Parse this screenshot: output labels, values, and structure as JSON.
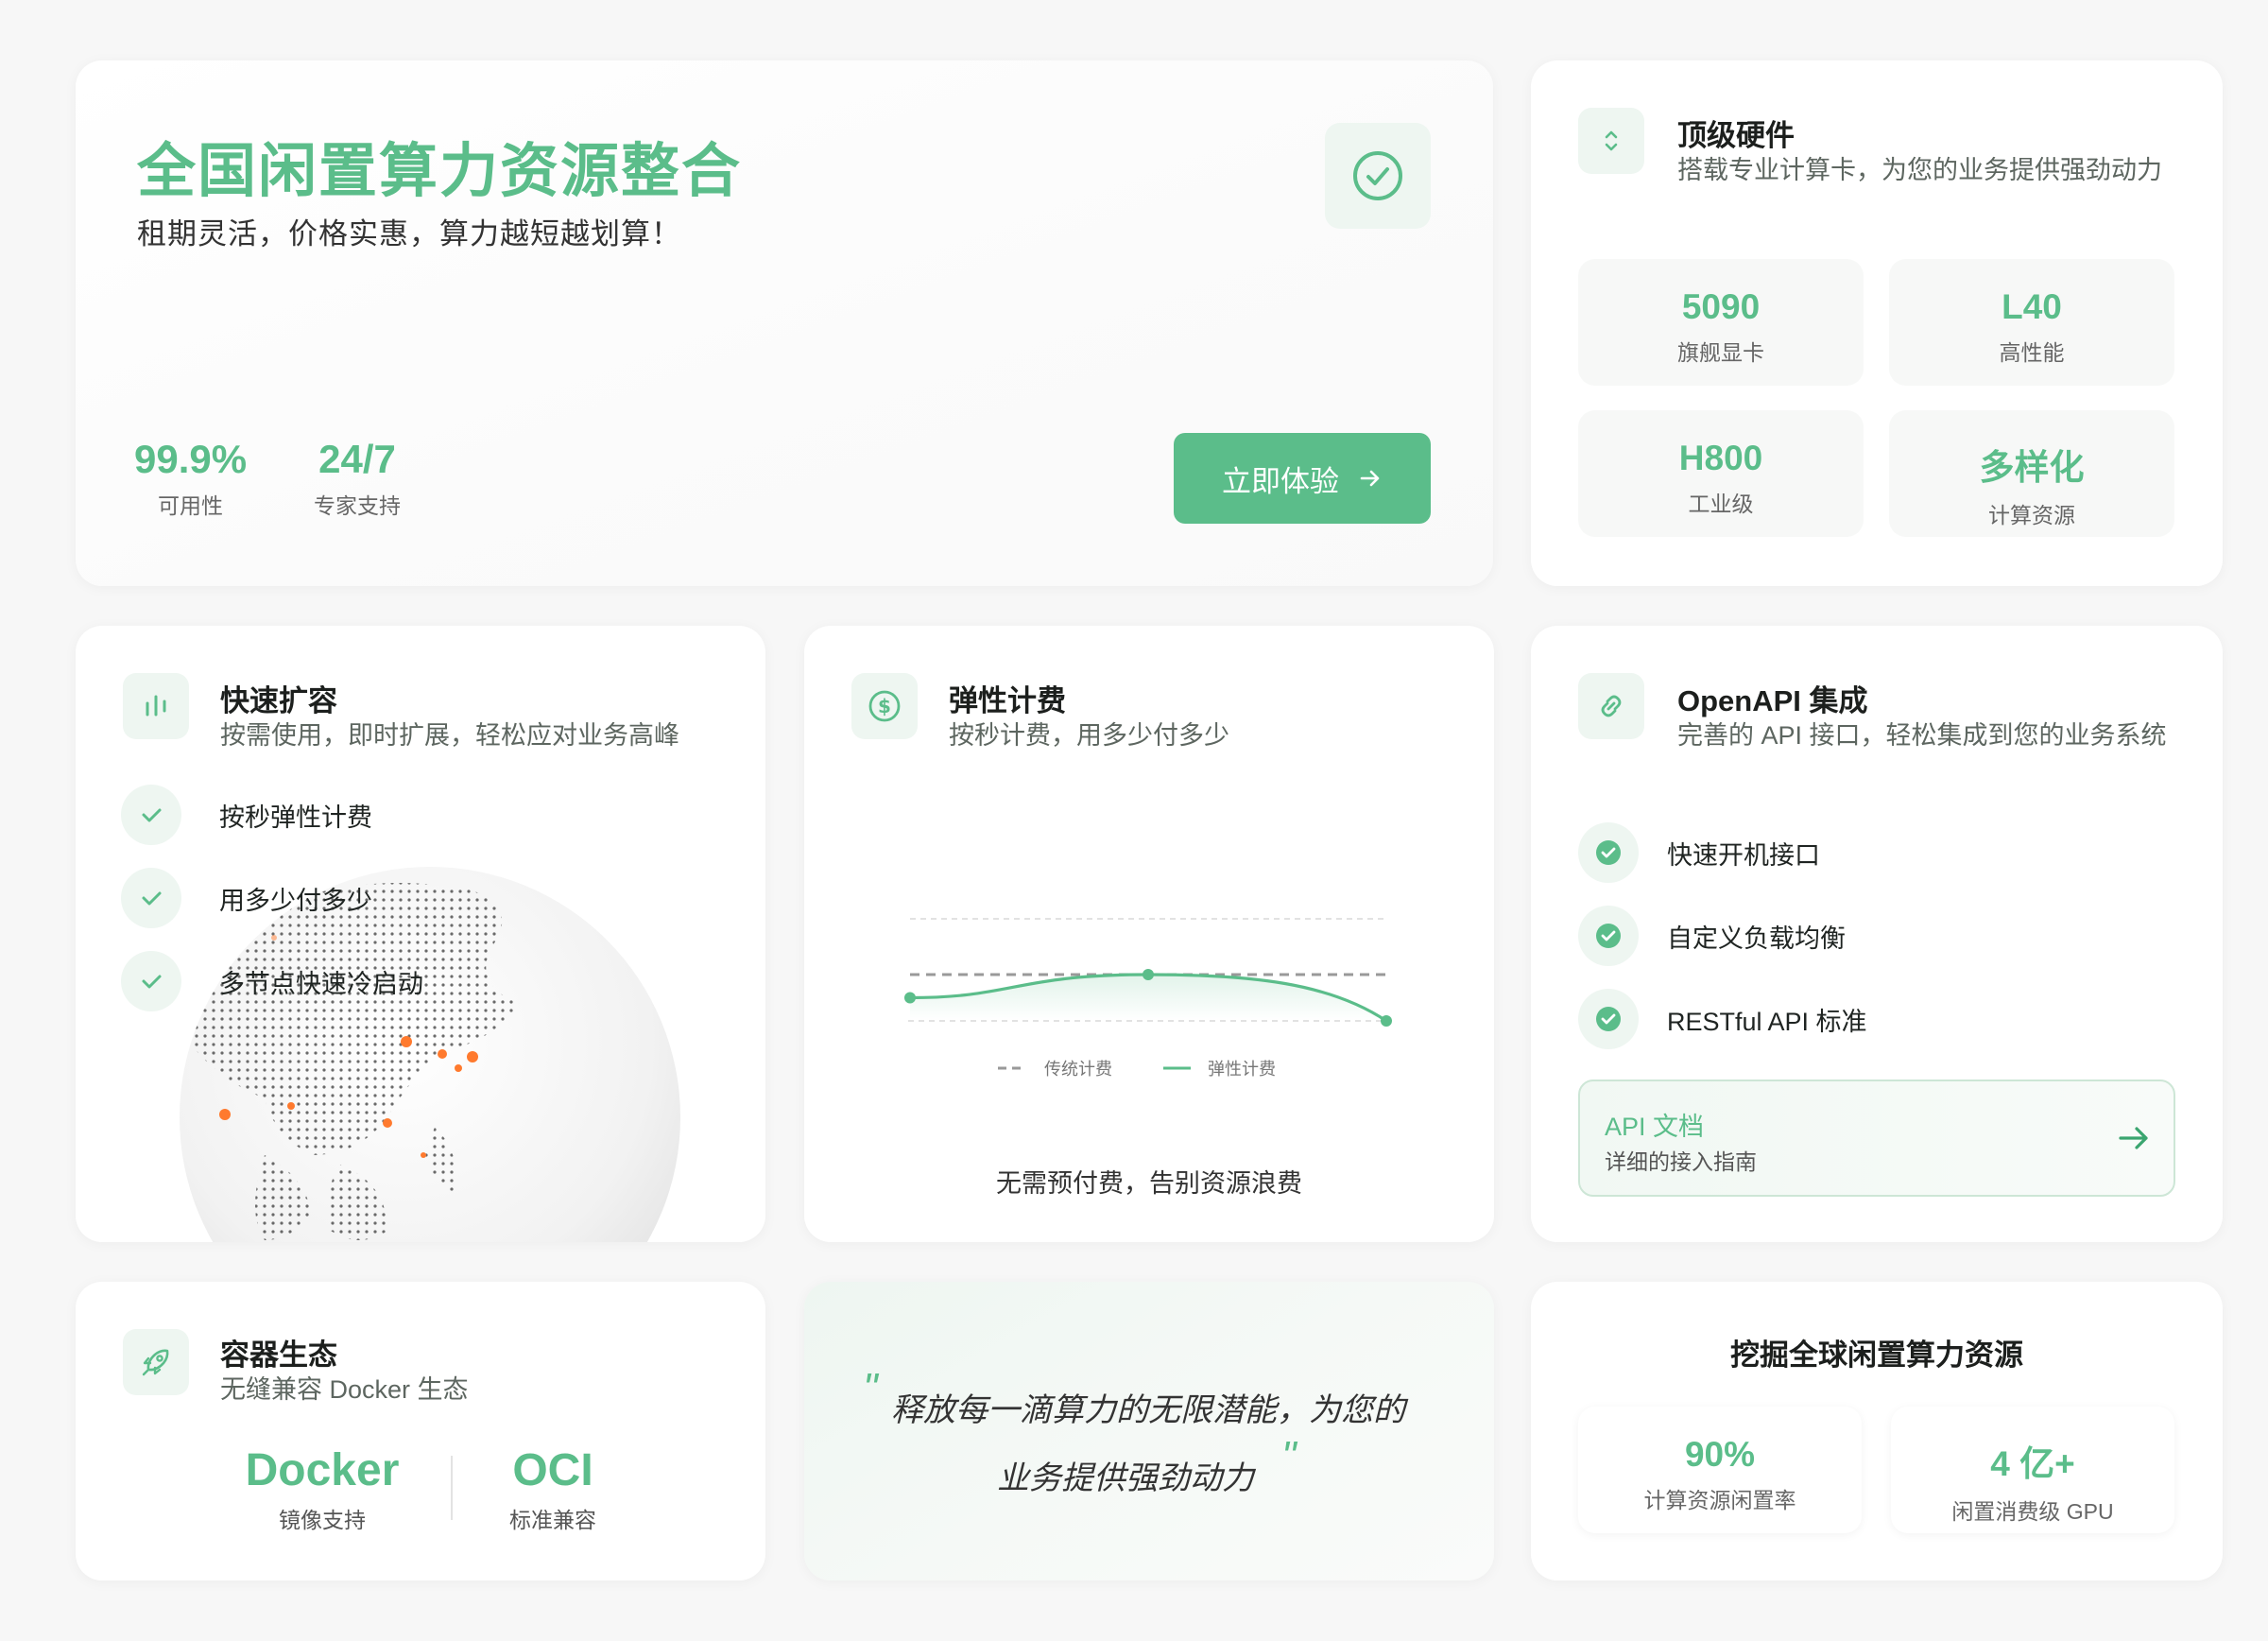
{
  "hero": {
    "title": "全国闲置算力资源整合",
    "subtitle": "租期灵活，价格实惠，算力越短越划算！",
    "stats": [
      {
        "value": "99.9%",
        "label": "可用性"
      },
      {
        "value": "24/7",
        "label": "专家支持"
      }
    ],
    "cta_label": "立即体验",
    "icon": "check-circle-icon"
  },
  "hardware": {
    "title": "顶级硬件",
    "description": "搭载专业计算卡，为您的业务提供强劲动力",
    "icon": "chevron-up-down-icon",
    "items": [
      {
        "value": "5090",
        "label": "旗舰显卡"
      },
      {
        "value": "L40",
        "label": "高性能"
      },
      {
        "value": "H800",
        "label": "工业级"
      },
      {
        "value": "多样化",
        "label": "计算资源"
      }
    ]
  },
  "scaling": {
    "title": "快速扩容",
    "description": "按需使用，即时扩展，轻松应对业务高峰",
    "icon": "bar-chart-icon",
    "features": [
      "按秒弹性计费",
      "用多少付多少",
      "多节点快速冷启动"
    ]
  },
  "billing": {
    "title": "弹性计费",
    "description": "按秒计费，用多少付多少",
    "icon": "dollar-icon",
    "footer": "无需预付费，告别资源浪费"
  },
  "chart_data": {
    "type": "line",
    "title": "",
    "xlabel": "",
    "ylabel": "",
    "legend_position": "bottom-center",
    "grid": true,
    "x": [
      0,
      1,
      2
    ],
    "series": [
      {
        "name": "传统计费",
        "style": "dashed",
        "color": "#999999",
        "values": [
          0.5,
          0.5,
          0.5
        ]
      },
      {
        "name": "弹性计费",
        "style": "solid",
        "color": "#5bbd8a",
        "values": [
          0.25,
          0.5,
          0.0
        ]
      }
    ]
  },
  "openapi": {
    "title": "OpenAPI 集成",
    "description": "完善的 API 接口，轻松集成到您的业务系统",
    "icon": "link-icon",
    "features": [
      "快速开机接口",
      "自定义负载均衡",
      "RESTful API 标准"
    ],
    "doc_title": "API 文档",
    "doc_sub": "详细的接入指南"
  },
  "container": {
    "title": "容器生态",
    "description": "无缝兼容 Docker 生态",
    "icon": "rocket-icon",
    "items": [
      {
        "value": "Docker",
        "label": "镜像支持"
      },
      {
        "value": "OCI",
        "label": "标准兼容"
      }
    ]
  },
  "quote": {
    "line1": "释放每一滴算力的无限潜能，为您的",
    "line2": "业务提供强劲动力"
  },
  "global": {
    "title": "挖掘全球闲置算力资源",
    "items": [
      {
        "value": "90%",
        "label": "计算资源闲置率"
      },
      {
        "value": "4 亿+",
        "label": "闲置消费级 GPU"
      }
    ]
  },
  "colors": {
    "accent": "#5bbd8a",
    "accent_light": "#eef6f1",
    "globe_dot": "#ff7a2e"
  }
}
